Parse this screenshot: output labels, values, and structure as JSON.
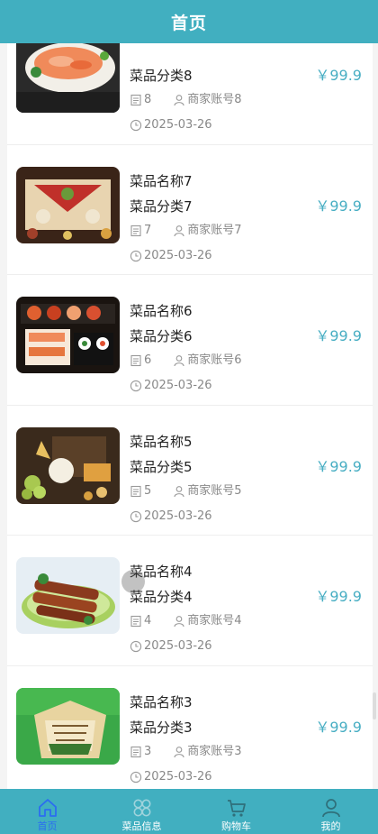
{
  "header": {
    "title": "首页"
  },
  "items": [
    {
      "name": "",
      "category": "菜品分类8",
      "price": "￥99.9",
      "count": "8",
      "merchant": "商家账号8",
      "date": "2025-03-26",
      "img": "sashimi"
    },
    {
      "name": "菜品名称7",
      "category": "菜品分类7",
      "price": "￥99.9",
      "count": "7",
      "merchant": "商家账号7",
      "date": "2025-03-26",
      "img": "banquet"
    },
    {
      "name": "菜品名称6",
      "category": "菜品分类6",
      "price": "￥99.9",
      "count": "6",
      "merchant": "商家账号6",
      "date": "2025-03-26",
      "img": "sushi"
    },
    {
      "name": "菜品名称5",
      "category": "菜品分类5",
      "price": "￥99.9",
      "count": "5",
      "merchant": "商家账号5",
      "date": "2025-03-26",
      "img": "cheese"
    },
    {
      "name": "菜品名称4",
      "category": "菜品分类4",
      "price": "￥99.9",
      "count": "4",
      "merchant": "商家账号4",
      "date": "2025-03-26",
      "img": "skewers"
    },
    {
      "name": "菜品名称3",
      "category": "菜品分类3",
      "price": "￥99.9",
      "count": "3",
      "merchant": "商家账号3",
      "date": "2025-03-26",
      "img": "wrap"
    }
  ],
  "tabbar": [
    {
      "label": "首页",
      "icon": "home-icon",
      "active": true
    },
    {
      "label": "菜品信息",
      "icon": "grid-icon",
      "active": false
    },
    {
      "label": "购物车",
      "icon": "cart-icon",
      "active": false
    },
    {
      "label": "我的",
      "icon": "user-icon",
      "active": false
    }
  ],
  "colors": {
    "accent": "#41afc0",
    "price": "#48aec3",
    "active_tab": "#2b6df0"
  }
}
